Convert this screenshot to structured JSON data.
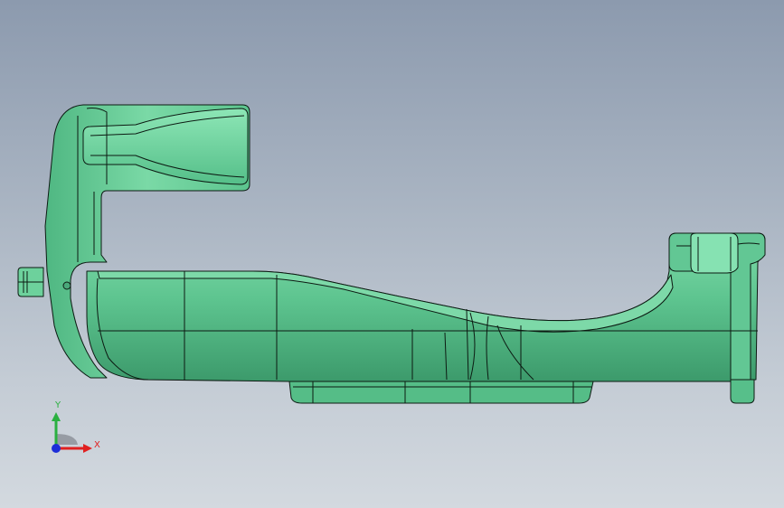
{
  "viewport": {
    "background_top": "#8c9aae",
    "background_bottom": "#d3d9df"
  },
  "part": {
    "fill_main": "#5dc48f",
    "fill_light": "#7fdcaa",
    "fill_shadow": "#3c9a6b",
    "edge_color": "#0c1a12"
  },
  "triad": {
    "x_label": "X",
    "y_label": "Y",
    "x_color": "#e02020",
    "y_color": "#2ab040",
    "z_color": "#1d2ed8"
  }
}
